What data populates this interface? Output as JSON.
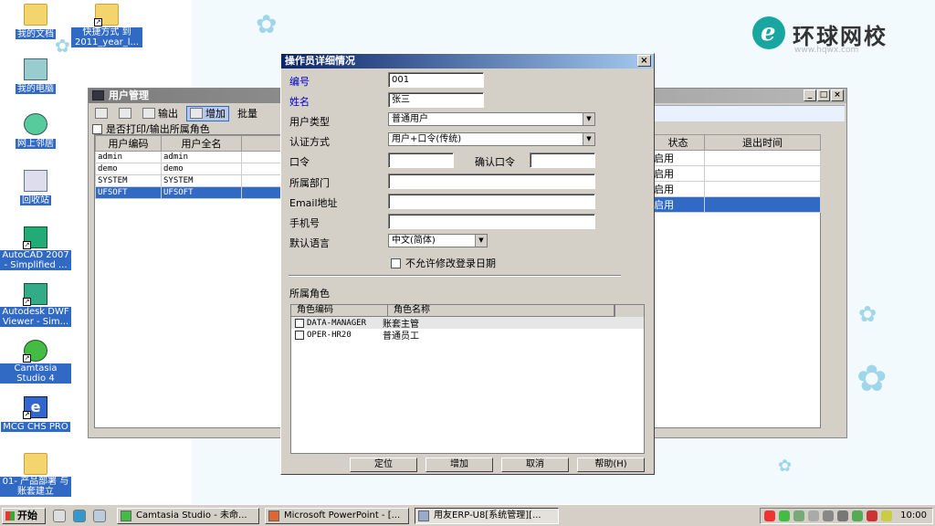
{
  "desktop": {
    "logo": {
      "text": "环球网校",
      "url": "www.hqwx.com"
    },
    "icons": [
      {
        "label": "我的文档",
        "icon": "folder-icon"
      },
      {
        "label": "快捷方式 到 2011_year_l...",
        "icon": "shortcut-folder-icon"
      },
      {
        "label": "我的电脑",
        "icon": "computer-icon"
      },
      {
        "label": "网上邻居",
        "icon": "network-icon"
      },
      {
        "label": "回收站",
        "icon": "recycle-bin-icon"
      },
      {
        "label": "AutoCAD 2007 - Simplified ...",
        "icon": "autocad-icon"
      },
      {
        "label": "Autodesk DWF Viewer - Sim...",
        "icon": "dwf-viewer-icon"
      },
      {
        "label": "Camtasia Studio 4",
        "icon": "camtasia-icon"
      },
      {
        "label": "MCG CHS PRO",
        "icon": "ie-icon"
      },
      {
        "label": "01- 产品部署 与账套建立",
        "icon": "folder-icon"
      }
    ]
  },
  "user_mgmt": {
    "title": "用户管理",
    "toolbar": {
      "export": "输出",
      "add": "增加",
      "batch": "批量"
    },
    "print_roles_check": "是否打印/输出所属角色",
    "columns": [
      "用户编码",
      "用户全名"
    ],
    "rows": [
      {
        "code": "admin",
        "name": "admin",
        "status": "启用"
      },
      {
        "code": "demo",
        "name": "demo",
        "status": "启用"
      },
      {
        "code": "SYSTEM",
        "name": "SYSTEM",
        "status": "启用"
      },
      {
        "code": "UFSOFT",
        "name": "UFSOFT",
        "status": "启用"
      }
    ],
    "right_columns": [
      "状态",
      "退出时间"
    ]
  },
  "dialog": {
    "title": "操作员详细情况",
    "fields": {
      "code_label": "编号",
      "code_value": "001",
      "name_label": "姓名",
      "name_value": "张三",
      "user_type_label": "用户类型",
      "user_type_value": "普通用户",
      "auth_label": "认证方式",
      "auth_value": "用户+口令(传统)",
      "password_label": "口令",
      "confirm_label": "确认口令",
      "dept_label": "所属部门",
      "email_label": "Email地址",
      "phone_label": "手机号",
      "lang_label": "默认语言",
      "lang_value": "中文(简体)",
      "no_modify_date": "不允许修改登录日期"
    },
    "roles_label": "所属角色",
    "role_columns": [
      "角色编码",
      "角色名称"
    ],
    "roles": [
      {
        "code": "DATA-MANAGER",
        "name": "账套主管"
      },
      {
        "code": "OPER-HR20",
        "name": "普通员工"
      }
    ],
    "buttons": {
      "locate": "定位",
      "add": "增加",
      "cancel": "取消",
      "help": "帮助(H)"
    }
  },
  "taskbar": {
    "start": "开始",
    "tasks": [
      "Camtasia Studio - 未命...",
      "Microsoft PowerPoint - [...",
      "用友ERP-U8[系统管理][..."
    ],
    "clock": "10:00"
  }
}
